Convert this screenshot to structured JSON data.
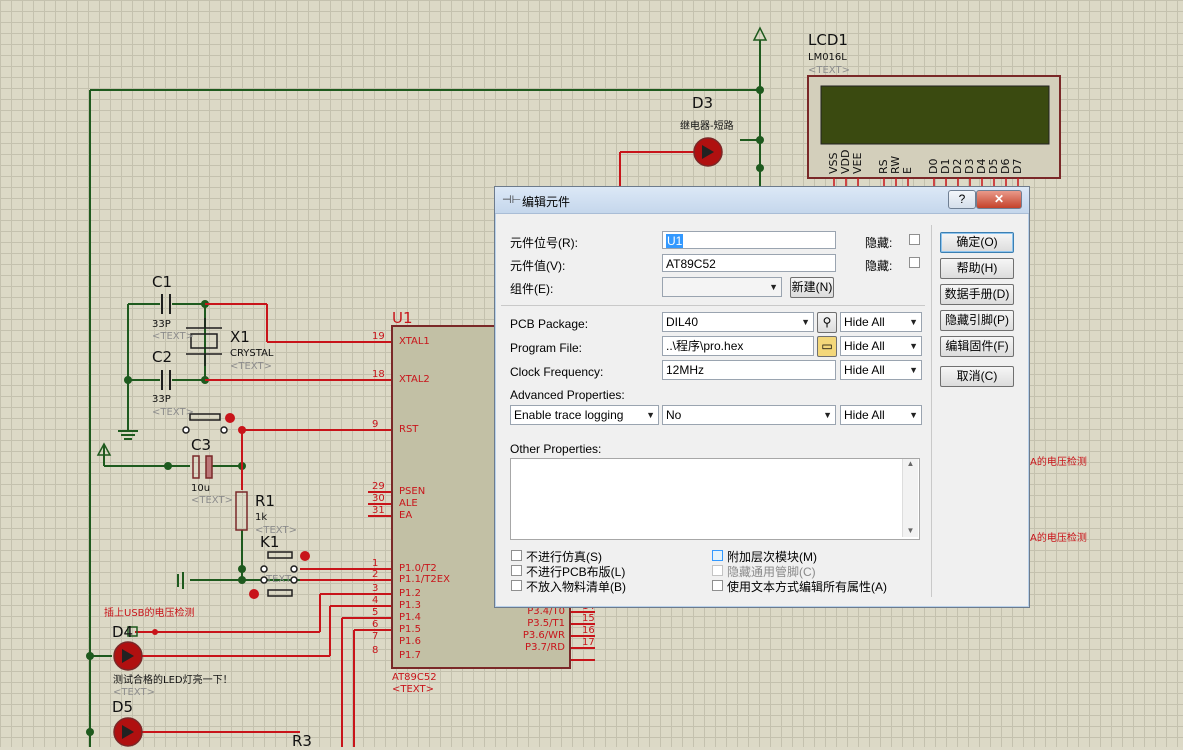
{
  "schematic": {
    "lcd": {
      "ref": "LCD1",
      "model": "LM016L",
      "text": "<TEXT>",
      "pins": [
        "VSS",
        "VDD",
        "VEE",
        "RS",
        "RW",
        "E",
        "D0",
        "D1",
        "D2",
        "D3",
        "D4",
        "D5",
        "D6",
        "D7"
      ]
    },
    "d3": {
      "ref": "D3",
      "desc": "继电器-短路"
    },
    "d3_behind": "D3",
    "c1": {
      "ref": "C1",
      "value": "33P",
      "text": "<TEXT>"
    },
    "c2": {
      "ref": "C2",
      "value": "33P",
      "text": "<TEXT>"
    },
    "x1": {
      "ref": "X1",
      "value": "CRYSTAL",
      "text": "<TEXT>"
    },
    "c3": {
      "ref": "C3",
      "value": "10u",
      "text": "<TEXT>"
    },
    "r1": {
      "ref": "R1",
      "value": "1k",
      "text": "<TEXT>"
    },
    "k1": {
      "ref": "K1",
      "text": "TEXT"
    },
    "u1": {
      "ref": "U1",
      "model": "AT89C52",
      "text": "<TEXT>"
    },
    "u1_pins_left": [
      {
        "num": "19",
        "name": "XTAL1"
      },
      {
        "num": "18",
        "name": "XTAL2"
      },
      {
        "num": "9",
        "name": "RST"
      },
      {
        "num": "29",
        "name": "PSEN"
      },
      {
        "num": "30",
        "name": "ALE"
      },
      {
        "num": "31",
        "name": "EA"
      },
      {
        "num": "1",
        "name": "P1.0/T2"
      },
      {
        "num": "2",
        "name": "P1.1/T2EX"
      },
      {
        "num": "3",
        "name": "P1.2"
      },
      {
        "num": "4",
        "name": "P1.3"
      },
      {
        "num": "5",
        "name": "P1.4"
      },
      {
        "num": "6",
        "name": "P1.5"
      },
      {
        "num": "7",
        "name": "P1.6"
      },
      {
        "num": "8",
        "name": "P1.7"
      }
    ],
    "u1_pins_right": [
      {
        "num": "14",
        "name": "P3.4/T0"
      },
      {
        "num": "15",
        "name": "P3.5/T1"
      },
      {
        "num": "16",
        "name": "P3.6/WR"
      },
      {
        "num": "17",
        "name": "P3.7/RD"
      }
    ],
    "usb_label": "插上USB的电压检测",
    "d4": {
      "ref": "D4",
      "desc": "测试合格的LED灯亮一下！",
      "text": "<TEXT>"
    },
    "d5": {
      "ref": "D5"
    },
    "r3": {
      "ref": "R3"
    },
    "right_label_1": "A的电压检测",
    "right_label_2": "A的电压检测"
  },
  "dialog": {
    "title": "编辑元件",
    "help_btn": "?",
    "close_btn": "✕",
    "part_ref_label": "元件位号(R):",
    "part_ref_value": "U1",
    "part_value_label": "元件值(V):",
    "part_value_value": "AT89C52",
    "component_label": "组件(E):",
    "component_value": "",
    "new_button": "新建(N)",
    "hidden_label_1": "隐藏:",
    "hidden_label_2": "隐藏:",
    "pcb_label": "PCB Package:",
    "pcb_value": "DIL40",
    "pcb_hide": "Hide All",
    "program_label": "Program File:",
    "program_value": "..\\程序\\pro.hex",
    "program_hide": "Hide All",
    "clock_label": "Clock Frequency:",
    "clock_value": "12MHz",
    "clock_hide": "Hide All",
    "advanced_label": "Advanced Properties:",
    "adv_prop": "Enable trace logging",
    "adv_value": "No",
    "adv_hide": "Hide All",
    "other_label": "Other Properties:",
    "other_value": "",
    "buttons": [
      "确定(O)",
      "帮助(H)",
      "数据手册(D)",
      "隐藏引脚(P)",
      "编辑固件(F)",
      "取消(C)"
    ],
    "checkboxes_left": [
      {
        "label": "不进行仿真(S)",
        "checked": false
      },
      {
        "label": "不进行PCB布版(L)",
        "checked": false
      },
      {
        "label": "不放入物料清单(B)",
        "checked": false
      }
    ],
    "checkboxes_right": [
      {
        "label": "附加层次模块(M)",
        "checked": false
      },
      {
        "label": "隐藏通用管脚(C)",
        "checked": false,
        "disabled": true
      },
      {
        "label": "使用文本方式编辑所有属性(A)",
        "checked": false
      }
    ]
  }
}
